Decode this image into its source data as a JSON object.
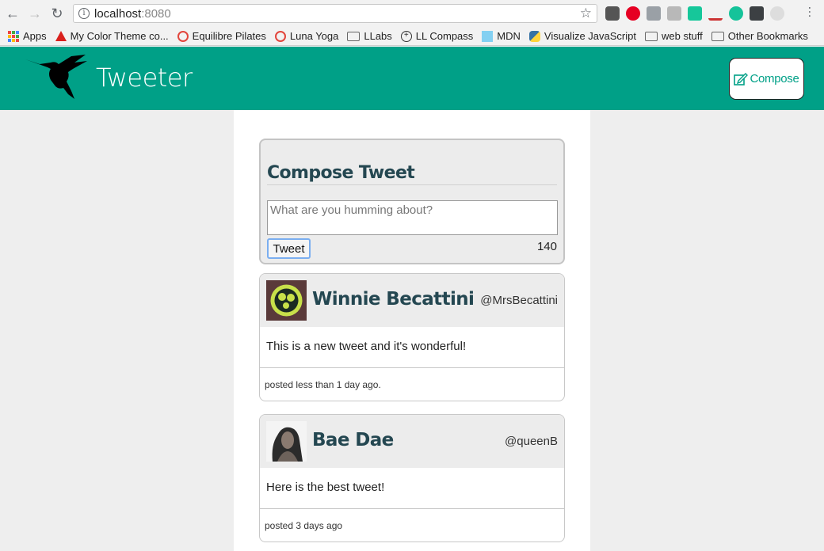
{
  "browser": {
    "url_host": "localhost",
    "url_port": ":8080",
    "bookmarks": [
      {
        "label": "Apps",
        "icon": "apps-icon"
      },
      {
        "label": "My Color Theme co...",
        "icon": "adobe-icon"
      },
      {
        "label": "Equilibre Pilates",
        "icon": "ring-icon"
      },
      {
        "label": "Luna Yoga",
        "icon": "ring-icon"
      },
      {
        "label": "LLabs",
        "icon": "folder-icon"
      },
      {
        "label": "LL Compass",
        "icon": "compass-icon"
      },
      {
        "label": "MDN",
        "icon": "mdn-icon"
      },
      {
        "label": "Visualize JavaScript",
        "icon": "python-icon"
      },
      {
        "label": "web stuff",
        "icon": "folder-icon"
      },
      {
        "label": "Other Bookmarks",
        "icon": "folder-icon"
      }
    ]
  },
  "header": {
    "brand": "Tweeter",
    "compose_label": "Compose",
    "accent_color": "#00a087"
  },
  "compose": {
    "title": "Compose Tweet",
    "placeholder": "What are you humming about?",
    "submit_label": "Tweet",
    "counter": "140"
  },
  "tweets": [
    {
      "name": "Winnie Becattini",
      "handle": "@MrsBecattini",
      "text": "This is a new tweet and it's wonderful!",
      "posted": "posted less than 1 day ago."
    },
    {
      "name": "Bae Dae",
      "handle": "@queenB",
      "text": "Here is the best tweet!",
      "posted": "posted 3 days ago"
    }
  ]
}
